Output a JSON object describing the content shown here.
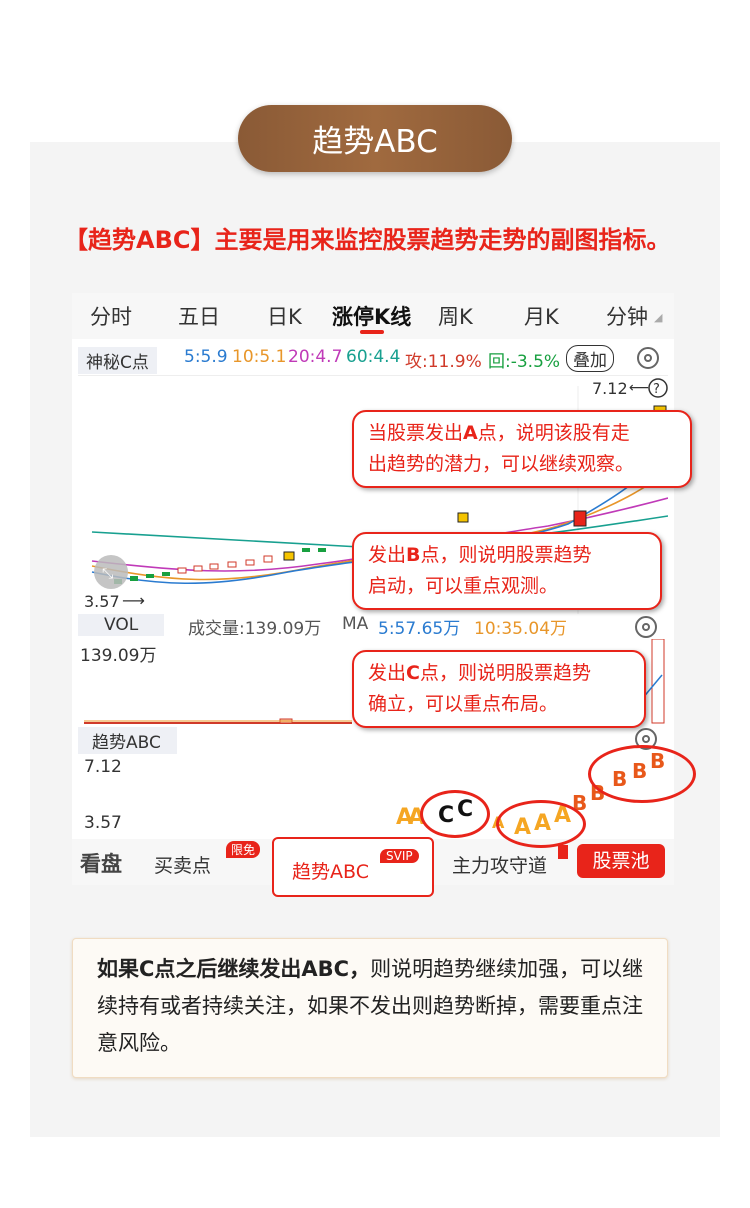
{
  "header": {
    "title": "趋势ABC"
  },
  "intro": {
    "text": "【趋势ABC】主要是用来监控股票趋势走势的副图指标。"
  },
  "tabs": [
    {
      "label": "分时"
    },
    {
      "label": "五日"
    },
    {
      "label": "日K"
    },
    {
      "label": "涨停K线"
    },
    {
      "label": "周K"
    },
    {
      "label": "月K"
    },
    {
      "label": "分钟"
    }
  ],
  "indicator": {
    "name": "神秘C点",
    "ma5": "5:5.9",
    "ma10": "10:5.1",
    "ma20": "20:4.7",
    "ma60": "60:4.4",
    "attack": "攻:11.9%",
    "retreat": "回:-3.5%",
    "overlay_btn": "叠加"
  },
  "price_chart": {
    "high_label": "7.12",
    "low_label": "3.57",
    "help_glyph": "?"
  },
  "volume": {
    "tag": "VOL",
    "volume_text": "成交量:139.09万",
    "ma_label": "MA",
    "ma5": "5:57.65万",
    "ma10": "10:35.04万",
    "max_label": "139.09万"
  },
  "subchart": {
    "name": "趋势ABC",
    "high_label": "7.12",
    "low_label": "3.57"
  },
  "abc_letters": {
    "a": "A",
    "b": "B",
    "c": "C"
  },
  "bottom_bar": {
    "brand": "看盘",
    "buy_sell": "买卖点",
    "limited_badge": "限免",
    "trend_abc": "趋势ABC",
    "svip_badge": "SVIP",
    "main_force": "主力攻守道",
    "stock_pool": "股票池"
  },
  "callouts": {
    "a": {
      "line1_pre": "当股票发出",
      "key": "A",
      "line1_post": "点，说明该股有走",
      "line2": "出趋势的潜力，可以继续观察。"
    },
    "b": {
      "line1_pre": "发出",
      "key": "B",
      "line1_post": "点，则说明股票趋势",
      "line2": "启动，可以重点观测。"
    },
    "c": {
      "line1_pre": "发出",
      "key": "C",
      "line1_post": "点，则说明股票趋势",
      "line2": "确立，可以重点布局。"
    }
  },
  "note": {
    "bold": "如果C点之后继续发出ABC，",
    "text": "则说明趋势继续加强，可以继续持有或者持续关注，如果不发出则趋势断掉，需要重点注意风险。"
  },
  "colors": {
    "accent": "#e8241a",
    "pill": "#9a6540",
    "ma5": "#2a7bd0",
    "ma10": "#e8962a",
    "ma20": "#c03ab8",
    "ma60": "#18a090",
    "letter_a": "#f5a623",
    "letter_b": "#e8581a",
    "letter_c": "#111111"
  }
}
